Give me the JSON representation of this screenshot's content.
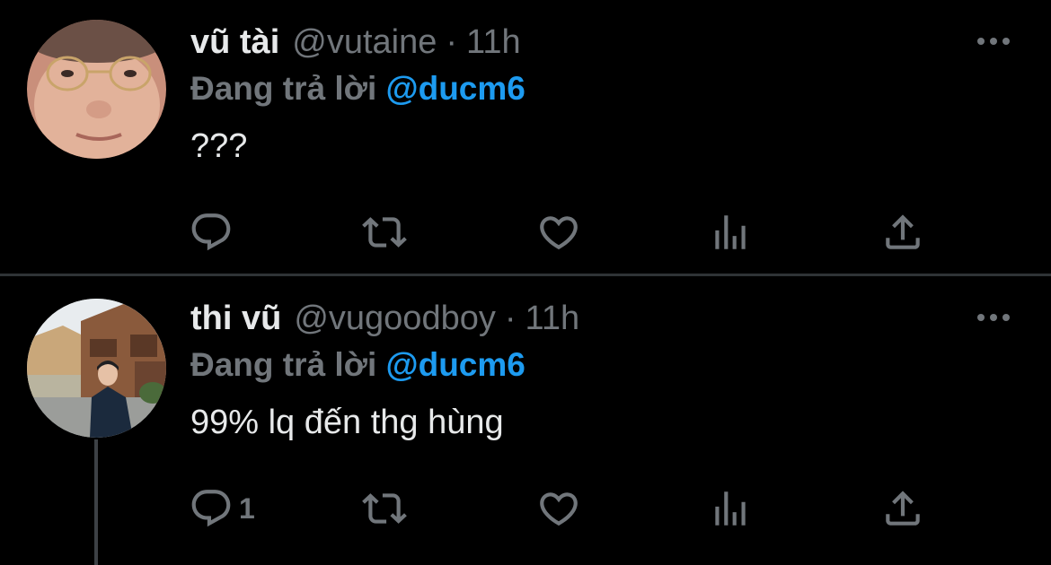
{
  "tweets": [
    {
      "name": "vũ tài",
      "handle": "@vutaine",
      "separator": "·",
      "time": "11h",
      "replying_prefix": "Đang trả lời",
      "replying_to": "@ducm6",
      "text": "???",
      "reply_count": "",
      "icons": [
        "more-icon",
        "reply-icon",
        "retweet-icon",
        "like-icon",
        "analytics-icon",
        "share-icon"
      ]
    },
    {
      "name": "thi vũ",
      "handle": "@vugoodboy",
      "separator": "·",
      "time": "11h",
      "replying_prefix": "Đang trả lời",
      "replying_to": "@ducm6",
      "text": "99% lq đến thg hùng",
      "reply_count": "1",
      "icons": [
        "more-icon",
        "reply-icon",
        "retweet-icon",
        "like-icon",
        "analytics-icon",
        "share-icon"
      ]
    }
  ],
  "colors": {
    "background": "#000000",
    "text_primary": "#e7e9ea",
    "text_secondary": "#71767b",
    "accent": "#1d9bf0",
    "divider": "#2f3336"
  }
}
